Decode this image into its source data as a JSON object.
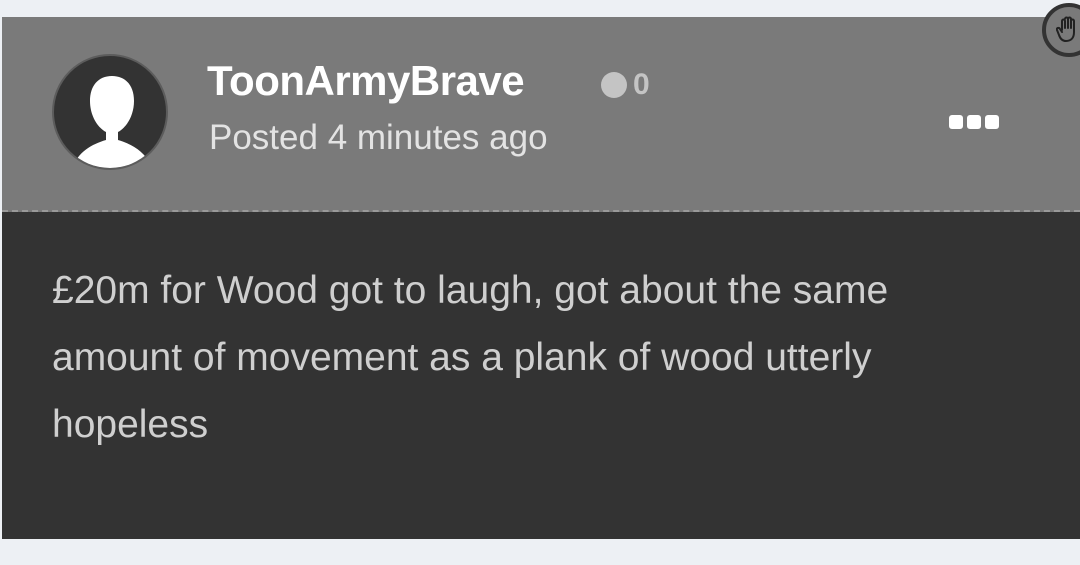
{
  "post": {
    "author": "ToonArmyBrave",
    "reputation": "0",
    "posted": "Posted 4 minutes ago",
    "content": "£20m for Wood got to laugh, got about the same amount of movement as a plank of wood utterly hopeless"
  },
  "icons": {
    "avatar": "default-user-silhouette",
    "reputation": "reputation-dot",
    "menu": "more-options-ellipsis",
    "overlay": "hand-pointer-icon"
  },
  "colors": {
    "header_bg": "#7a7a7a",
    "body_bg": "#333333",
    "page_bg": "#edf0f4"
  }
}
